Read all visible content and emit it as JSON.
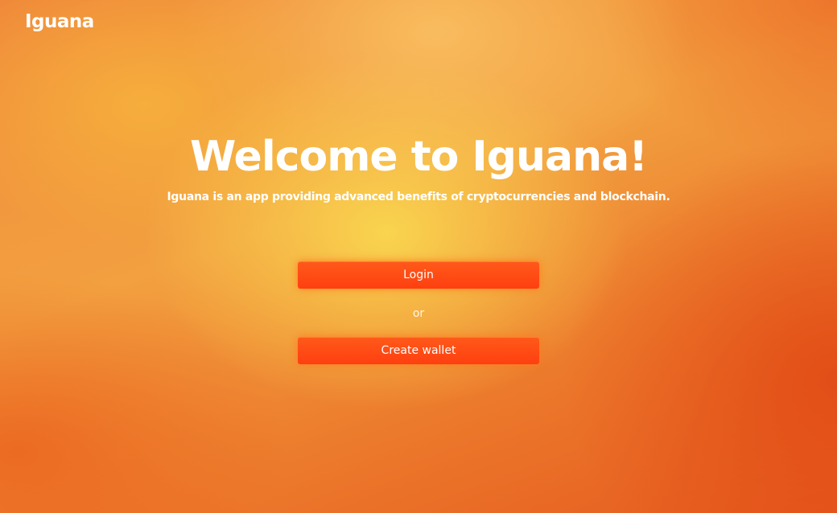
{
  "header": {
    "logo_text": "Iguana"
  },
  "welcome": {
    "title": "Welcome to Iguana!",
    "subtitle": "Iguana is an app providing advanced benefits of cryptocurrencies and blockchain."
  },
  "actions": {
    "login_label": "Login",
    "separator": "or",
    "create_wallet_label": "Create wallet"
  },
  "colors": {
    "button": "#ff4a14",
    "background_warm": "#f8c04a",
    "background_edge": "#e65a1e",
    "text": "#ffffff"
  }
}
